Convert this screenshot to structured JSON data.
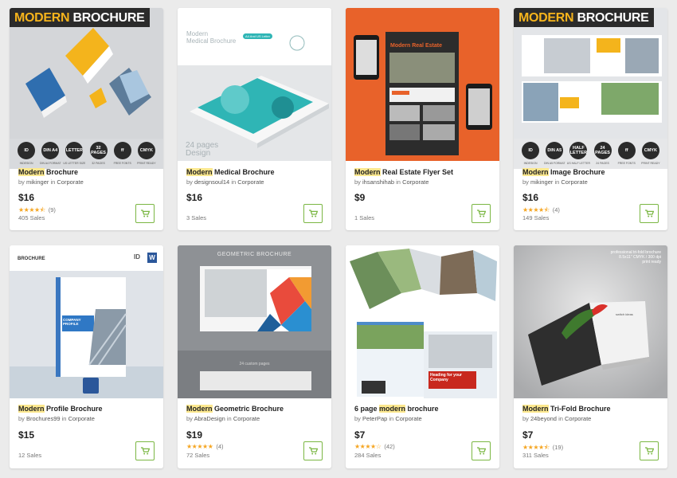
{
  "products": [
    {
      "title_highlight": "Modern",
      "title_rest": " Brochure",
      "by": "by",
      "author": "mikinger",
      "in": "in",
      "category": "Corporate",
      "price": "$16",
      "rating_count": "(9)",
      "sales": "405 Sales",
      "banner_left": "MODERN",
      "banner_right": "BROCHURE",
      "badges": [
        {
          "label": "ID",
          "sub": "INDESIGN"
        },
        {
          "label": "DIN A4",
          "sub": "DIN A4 FORMAT"
        },
        {
          "label": "LETTER",
          "sub": "US LETTER SIZE"
        },
        {
          "label": "32 PAGES",
          "sub": "32 PAGES"
        },
        {
          "label": "ff",
          "sub": "FREE FONTS"
        },
        {
          "label": "CMYK",
          "sub": "PRINT READY"
        }
      ]
    },
    {
      "title_highlight": "Modern",
      "title_rest": " Medical Brochure",
      "by": "by",
      "author": "designsoul14",
      "in": "in",
      "category": "Corporate",
      "price": "$16",
      "sales": "3 Sales",
      "thumb_line1": "Modern",
      "thumb_line2": "Medical Brochure",
      "thumb_tag": "A4 And US Letter",
      "thumb_pages": "24 pages",
      "thumb_pages2": "Design"
    },
    {
      "title_highlight": "Modern",
      "title_rest": " Real Estate Flyer Set",
      "by": "by",
      "author": "ihsanshihab",
      "in": "in",
      "category": "Corporate",
      "price": "$9",
      "sales": "1 Sales",
      "thumb_heading": "Modern Real Estate"
    },
    {
      "title_highlight": "Modern",
      "title_rest": " Image Brochure",
      "by": "by",
      "author": "mikinger",
      "in": "in",
      "category": "Corporate",
      "price": "$16",
      "rating_count": "(4)",
      "sales": "149 Sales",
      "banner_left": "MODERN",
      "banner_right": "BROCHURE",
      "badges": [
        {
          "label": "ID",
          "sub": "INDESIGN"
        },
        {
          "label": "DIN A5",
          "sub": "DIN A5 FORMAT"
        },
        {
          "label": "HALF LETTER",
          "sub": "US HALF LETTER"
        },
        {
          "label": "24 PAGES",
          "sub": "24 PAGES"
        },
        {
          "label": "ff",
          "sub": "FREE FONTS"
        },
        {
          "label": "CMYK",
          "sub": "PRINT READY"
        }
      ]
    },
    {
      "title_highlight": "Modern",
      "title_rest": " Profile Brochure",
      "by": "by",
      "author": "Brochures99",
      "in": "in",
      "category": "Corporate",
      "price": "$15",
      "sales": "12 Sales",
      "thumb_brand": "BROCHURE",
      "thumb_company": "COMPANY PROFILE",
      "thumb_id": "ID",
      "thumb_w": "W"
    },
    {
      "title_highlight": "Modern",
      "title_rest": " Geometric Brochure",
      "by": "by",
      "author": "AbraDesign",
      "in": "in",
      "category": "Corporate",
      "price": "$19",
      "rating_count": "(4)",
      "sales": "72 Sales",
      "thumb_heading": "GEOMETRIC BROCHURE",
      "thumb_pages": "24 custom pages"
    },
    {
      "title_pre": "6 page ",
      "title_highlight": "modern",
      "title_rest": " brochure",
      "by": "by",
      "author": "PeterPap",
      "in": "in",
      "category": "Corporate",
      "price": "$7",
      "rating_count": "(42)",
      "sales": "284 Sales",
      "thumb_heading": "Heading for your Company"
    },
    {
      "title_highlight": "Modern",
      "title_rest": " Tri-Fold Brochure",
      "by": "by",
      "author": "24beyond",
      "in": "in",
      "category": "Corporate",
      "price": "$7",
      "rating_count": "(19)",
      "sales": "311 Sales",
      "thumb_line1": "professional tri-fold brochure",
      "thumb_line2": "8.5x11\" CMYK / 300 dpi",
      "thumb_line3": "print ready",
      "thumb_mini": "switch ideas"
    }
  ],
  "ratings": [
    4.5,
    null,
    null,
    4.5,
    null,
    5,
    4,
    4.5
  ],
  "colors": {
    "accent_green": "#7bb743",
    "star": "#f5a623",
    "highlight": "#fce88f",
    "banner_yellow": "#f6b41c",
    "orange_bg": "#e8622a"
  },
  "icons": {
    "cart": "shopping-cart-icon",
    "star": "star-icon"
  }
}
